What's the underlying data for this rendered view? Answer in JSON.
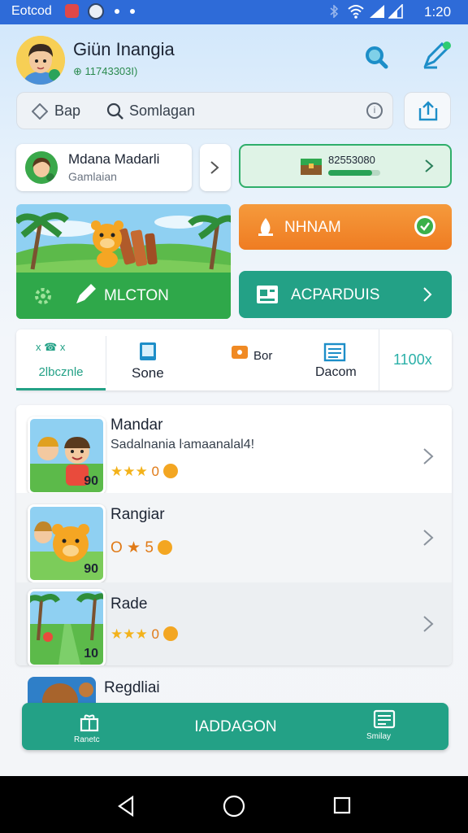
{
  "status_bar": {
    "brand": "Eotcod",
    "time": "1:20",
    "icons": [
      "record-icon",
      "app-icon",
      "bluetooth-icon",
      "wifi-icon",
      "signal-icon",
      "signal-icon"
    ]
  },
  "header": {
    "title": "Giün Inangia",
    "id_text": "⊕ 11743303I)"
  },
  "search": {
    "left_label": "Bap",
    "value": "Somlagan",
    "info": "i"
  },
  "profile_card": {
    "name": "Mdana Madarli",
    "subtitle": "Gamlaian"
  },
  "progress_card": {
    "value_text": "82553080",
    "progress": 0.85
  },
  "hero": {
    "label": "MLCTON"
  },
  "orange_button": {
    "label": "NHNAM"
  },
  "teal_button": {
    "label": "ACPARDUIS"
  },
  "tabs": [
    {
      "label": "2lbcznle",
      "icon_text": "x ☎ x",
      "active": true
    },
    {
      "label": "Sone",
      "icon": "tablet-icon"
    },
    {
      "label": "Bor",
      "icon": "gift-icon"
    },
    {
      "label": "Dacom",
      "icon": "document-icon"
    },
    {
      "label": "1100x"
    }
  ],
  "games": [
    {
      "name": "Mandar",
      "desc": "Sadalnania ŀamaanalal4!",
      "rating_text": "0",
      "badge": "90",
      "stars": 3
    },
    {
      "name": "Rangiar",
      "desc": "",
      "rating_text": "O ★ 5",
      "badge": "90",
      "stars": 2
    },
    {
      "name": "Rade",
      "desc": "",
      "rating_text": "0",
      "badge": "10",
      "stars": 3
    }
  ],
  "partial_row": {
    "name": "Regdliai"
  },
  "bottom_bar": {
    "left_label": "Ranetc",
    "center_label": "IADDAGON",
    "right_label": "Smilay"
  },
  "colors": {
    "status_bar": "#2e6bd8",
    "teal": "#23a186",
    "green": "#2fa84a",
    "orange": "#ef7c22"
  }
}
